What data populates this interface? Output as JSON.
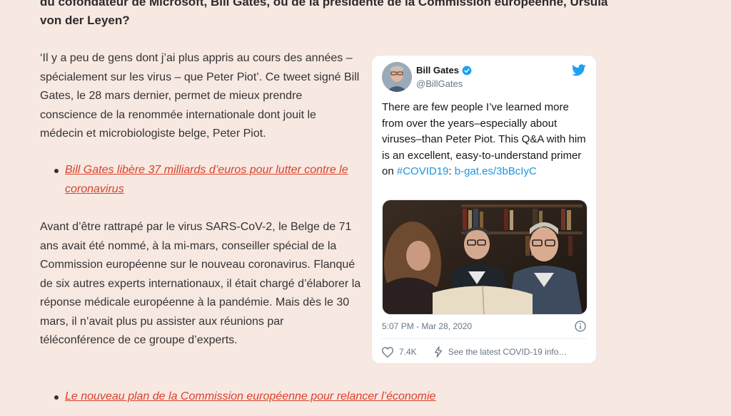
{
  "article": {
    "lead_line1": "du cofondateur de Microsoft, Bill Gates, ou de la présidente de la Commission européenne, Ursula",
    "lead_line2": "von der Leyen?",
    "para1": "‘Il y a peu de gens dont j’ai plus appris au cours des années – spécialement sur les virus – que Peter Piot’. Ce tweet signé Bill Gates, le 28 mars dernier, permet de mieux prendre conscience de la renommée internationale dont jouit le médecin et microbiologiste belge, Peter Piot.",
    "related1": "Bill Gates libère 37 milliards d’euros pour lutter contre le coronavirus",
    "para2": "Avant d’être rattrapé par le virus SARS-CoV-2, le Belge de 71 ans avait été nommé, à la mi-mars, conseiller spécial de la Commission européenne sur le nouveau coronavirus. Flanqué de six autres experts internationaux, il était chargé d’élaborer la réponse médicale européenne à la pandémie. Mais dès le 30 mars, il n’avait plus pu assister aux réunions par téléconférence de ce groupe d’experts.",
    "related2": "Le nouveau plan de la Commission européenne pour relancer l’économie"
  },
  "tweet": {
    "name": "Bill Gates",
    "handle": "@BillGates",
    "text_main": "There are few people I’ve learned more from over the years–especially about viruses–than Peter Piot. This Q&A with him is an excellent, easy-to-understand primer on ",
    "hashtag": "#COVID19",
    "sep": ": ",
    "link": "b-gat.es/3bBcIyC",
    "timestamp": "5:07 PM - Mar 28, 2020",
    "likes": "7.4K",
    "covid_info": "See the latest COVID-19 info…",
    "icons": [
      "verified-badge-icon",
      "twitter-bird-icon",
      "info-icon",
      "heart-icon",
      "lightning-icon"
    ],
    "colors": {
      "link": "#1b95e0",
      "brand": "#1da1f2",
      "article_link": "#d9412b",
      "page_bg": "#f8e8e2"
    }
  }
}
